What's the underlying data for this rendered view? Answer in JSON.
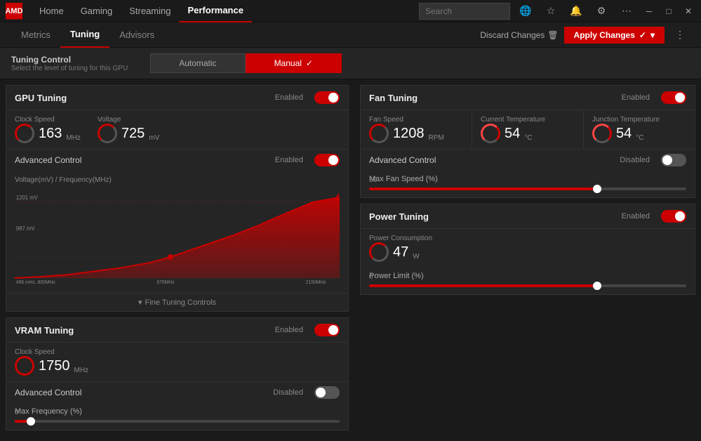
{
  "titlebar": {
    "logo": "AMD",
    "nav": [
      {
        "label": "Home",
        "active": false
      },
      {
        "label": "Gaming",
        "active": false
      },
      {
        "label": "Streaming",
        "active": false
      },
      {
        "label": "Performance",
        "active": true
      }
    ],
    "search_placeholder": "Search",
    "icons": [
      "globe",
      "star",
      "bell",
      "gear",
      "dots"
    ],
    "window_controls": [
      "minimize",
      "maximize",
      "close"
    ]
  },
  "subnav": {
    "items": [
      {
        "label": "Metrics",
        "active": false
      },
      {
        "label": "Tuning",
        "active": true
      },
      {
        "label": "Advisors",
        "active": false
      }
    ],
    "discard_label": "Discard Changes",
    "apply_label": "Apply Changes"
  },
  "tuning_control": {
    "title": "Tuning Control",
    "subtitle": "Select the level of tuning for this GPU",
    "modes": [
      {
        "label": "Automatic",
        "active": false
      },
      {
        "label": "Manual",
        "active": true
      }
    ]
  },
  "gpu_tuning": {
    "title": "GPU Tuning",
    "status": "Enabled",
    "toggle": "on",
    "clock_speed_label": "Clock Speed",
    "clock_speed_value": "163",
    "clock_speed_unit": "MHz",
    "voltage_label": "Voltage",
    "voltage_value": "725",
    "voltage_unit": "mV",
    "advanced_label": "Advanced Control",
    "advanced_status": "Enabled",
    "advanced_toggle": "on",
    "chart_title": "Voltage(mV) / Frequency(MHz)",
    "chart_y1": "1201 mV",
    "chart_y2": "987 mV",
    "chart_x1": "496 mHz, 800MHz",
    "chart_x2": "675MHz",
    "chart_x3": "2150MHz",
    "fine_tuning_label": "Fine Tuning Controls"
  },
  "vram_tuning": {
    "title": "VRAM Tuning",
    "status": "Enabled",
    "toggle": "on",
    "clock_speed_label": "Clock Speed",
    "clock_speed_value": "1750",
    "clock_speed_unit": "MHz",
    "advanced_label": "Advanced Control",
    "advanced_status": "Disabled",
    "advanced_toggle": "off",
    "slider_label": "Max Frequency (%)",
    "slider_value": "0",
    "slider_percent": 5
  },
  "fan_tuning": {
    "title": "Fan Tuning",
    "status": "Enabled",
    "toggle": "on",
    "fan_speed_label": "Fan Speed",
    "fan_speed_value": "1208",
    "fan_speed_unit": "RPM",
    "current_temp_label": "Current Temperature",
    "current_temp_value": "54",
    "current_temp_unit": "°C",
    "junction_temp_label": "Junction Temperature",
    "junction_temp_value": "54",
    "junction_temp_unit": "°C",
    "advanced_label": "Advanced Control",
    "advanced_status": "Disabled",
    "advanced_toggle": "off",
    "slider_label": "Max Fan Speed (%)",
    "slider_value": "50",
    "slider_percent": 72
  },
  "power_tuning": {
    "title": "Power Tuning",
    "status": "Enabled",
    "toggle": "on",
    "power_label": "Power Consumption",
    "power_value": "47",
    "power_unit": "W",
    "slider_label": "Power Limit (%)",
    "slider_value": "0",
    "slider_percent": 72
  }
}
